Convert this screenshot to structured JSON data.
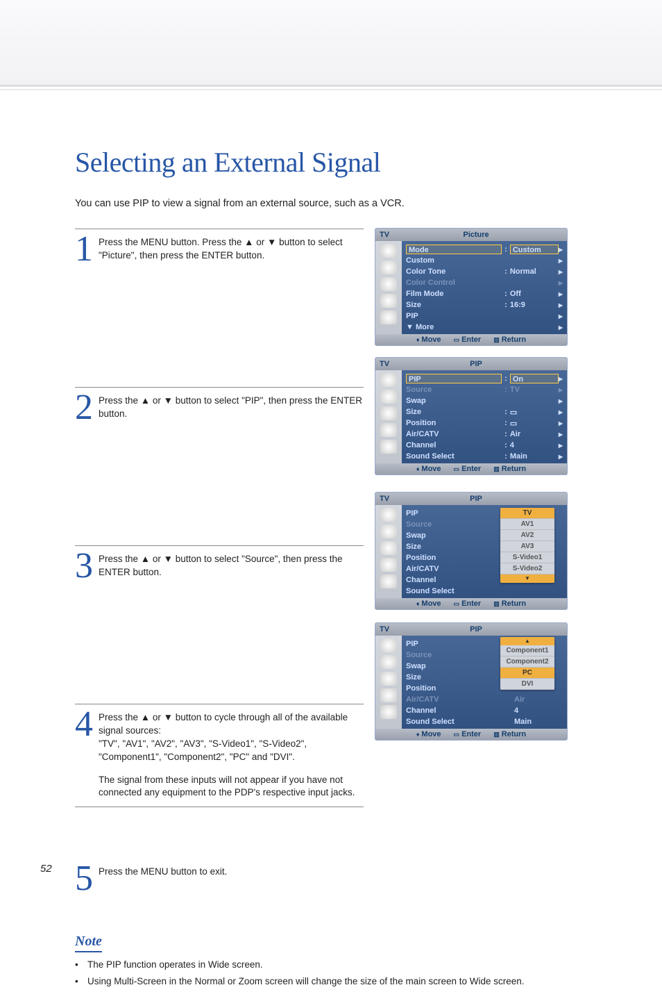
{
  "page_number": "52",
  "title": "Selecting an External Signal",
  "intro": "You can use PIP to view a signal from an external source, such as a VCR.",
  "steps": [
    {
      "num": "1",
      "text": "Press the MENU button. Press the ▲ or ▼ button to select \"Picture\", then press the ENTER button."
    },
    {
      "num": "2",
      "text": "Press the ▲ or ▼ button to select \"PIP\", then press the ENTER button."
    },
    {
      "num": "3",
      "text": "Press the ▲ or ▼ button to select \"Source\", then press the ENTER button."
    },
    {
      "num": "4",
      "text": "Press the ▲ or ▼ button to cycle through all of the available signal sources:\n\"TV\", \"AV1\", \"AV2\", \"AV3\", \"S-Video1\", \"S-Video2\", \"Component1\", \"Component2\", \"PC\" and \"DVI\".",
      "extra": "The signal from these inputs will not appear if you have not connected any equipment to the PDP's respective input jacks."
    },
    {
      "num": "5",
      "text": "Press the MENU button to exit."
    }
  ],
  "note": {
    "heading": "Note",
    "bullets": [
      "The PIP function operates in Wide screen.",
      "Using Multi-Screen in the Normal or Zoom screen will change the size of the main screen to Wide screen."
    ]
  },
  "osd_common": {
    "tv": "TV",
    "move": "Move",
    "enter": "Enter",
    "return": "Return"
  },
  "osd1": {
    "title": "Picture",
    "rows": [
      {
        "lab": "Mode",
        "val": "Custom",
        "sel": true
      },
      {
        "lab": "Custom",
        "val": ""
      },
      {
        "lab": "Color Tone",
        "val": "Normal"
      },
      {
        "lab": "Color Control",
        "val": "",
        "dim": true
      },
      {
        "lab": "Film Mode",
        "val": "Off"
      },
      {
        "lab": "Size",
        "val": "16:9"
      },
      {
        "lab": "PIP",
        "val": ""
      },
      {
        "lab": "▼ More",
        "val": ""
      }
    ]
  },
  "osd2": {
    "title": "PIP",
    "rows": [
      {
        "lab": "PIP",
        "val": "On",
        "sel": true
      },
      {
        "lab": "Source",
        "val": "TV",
        "dim": true
      },
      {
        "lab": "Swap",
        "val": ""
      },
      {
        "lab": "Size",
        "val": "▭"
      },
      {
        "lab": "Position",
        "val": "▭"
      },
      {
        "lab": "Air/CATV",
        "val": "Air"
      },
      {
        "lab": "Channel",
        "val": "4"
      },
      {
        "lab": "Sound Select",
        "val": "Main"
      }
    ]
  },
  "osd3": {
    "title": "PIP",
    "rows": [
      {
        "lab": "PIP",
        "val": ":"
      },
      {
        "lab": "Source",
        "val": ":",
        "dim": true
      },
      {
        "lab": "Swap",
        "val": ":"
      },
      {
        "lab": "Size",
        "val": ":"
      },
      {
        "lab": "Position",
        "val": ":"
      },
      {
        "lab": "Air/CATV",
        "val": ":"
      },
      {
        "lab": "Channel",
        "val": ":"
      },
      {
        "lab": "Sound Select",
        "val": ":"
      }
    ],
    "dropdown": [
      "TV",
      "AV1",
      "AV2",
      "AV3",
      "S-Video1",
      "S-Video2"
    ],
    "dropdown_sel": "TV"
  },
  "osd4": {
    "title": "PIP",
    "rows": [
      {
        "lab": "PIP",
        "val": ":"
      },
      {
        "lab": "Source",
        "val": ":",
        "dim": true
      },
      {
        "lab": "Swap",
        "val": ":"
      },
      {
        "lab": "Size",
        "val": ":"
      },
      {
        "lab": "Position",
        "val": ":"
      },
      {
        "lab": "Air/CATV",
        "val": ": Air",
        "dim": true
      },
      {
        "lab": "Channel",
        "val": ": 4"
      },
      {
        "lab": "Sound Select",
        "val": ": Main"
      }
    ],
    "dropdown": [
      "Component1",
      "Component2",
      "PC",
      "DVI"
    ],
    "dropdown_sel": "PC"
  }
}
